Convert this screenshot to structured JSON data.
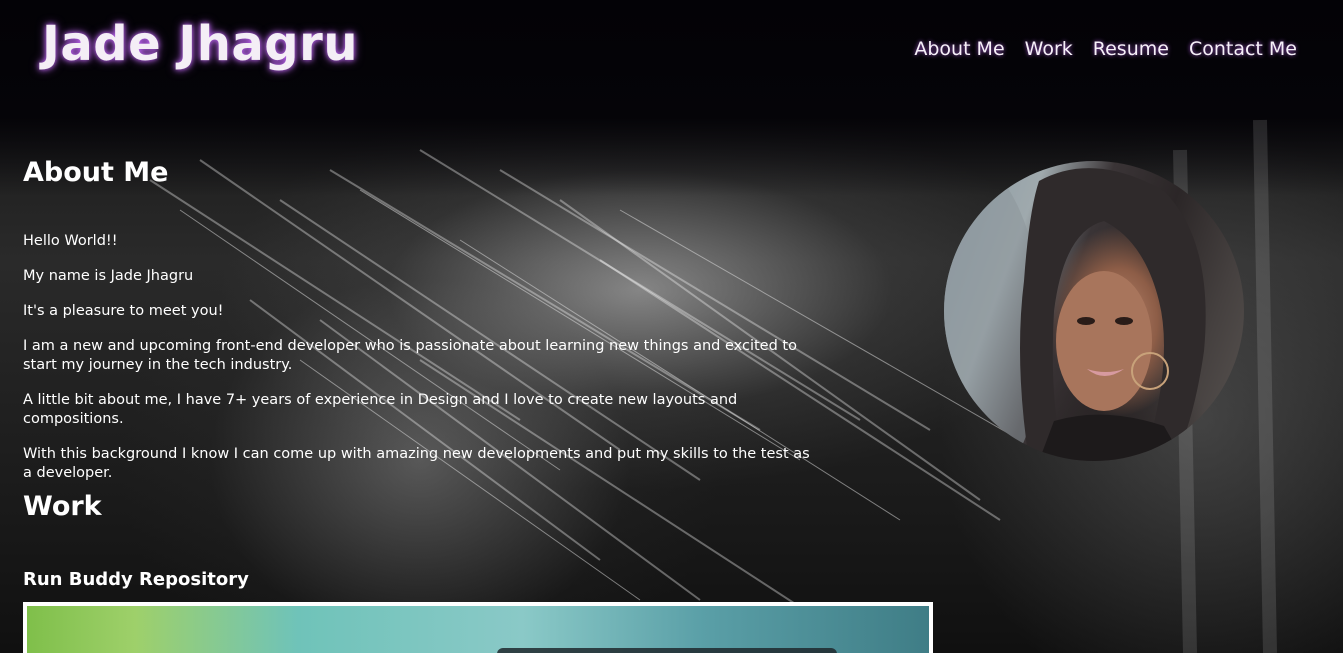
{
  "header": {
    "site_title": "Jade Jhagru",
    "nav": [
      {
        "label": "About Me"
      },
      {
        "label": "Work"
      },
      {
        "label": "Resume"
      },
      {
        "label": "Contact Me"
      }
    ]
  },
  "about": {
    "title": "About Me",
    "paragraphs": [
      "Hello World!!",
      "My name is Jade Jhagru",
      "It's a pleasure to meet you!",
      "I am a new and upcoming front-end developer who is passionate about learning new things and excited to start my journey in the tech industry.",
      "A little bit about me, I have 7+ years of experience in Design and I love to create new layouts and compositions.",
      "With this background I know I can come up with amazing new developments and put my skills to the test as a developer."
    ]
  },
  "work": {
    "title": "Work",
    "items": [
      {
        "title": "Run Buddy Repository"
      }
    ]
  },
  "colors": {
    "glow": "#c86bff",
    "text": "#ffffff",
    "background": "#050307"
  }
}
